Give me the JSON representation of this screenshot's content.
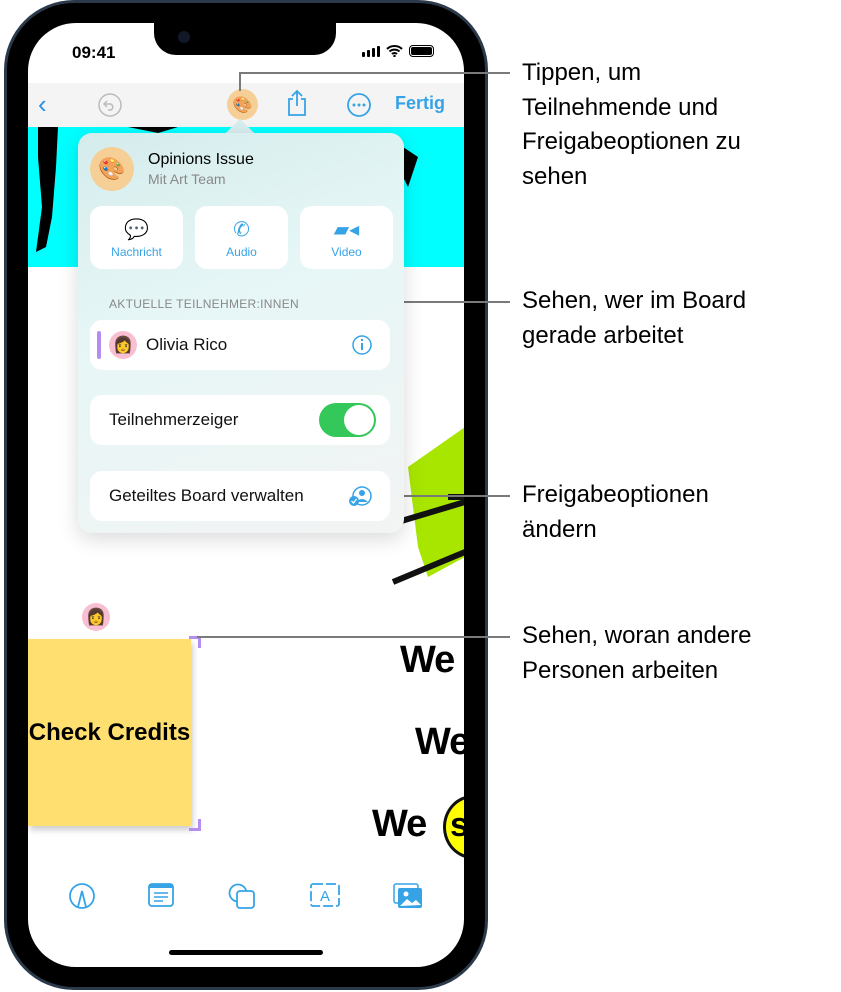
{
  "status_bar": {
    "time": "09:41"
  },
  "nav": {
    "back_icon": "chevron-left-icon",
    "undo_icon": "undo-icon",
    "collab_icon": "palette-icon",
    "share_icon": "share-icon",
    "more_icon": "ellipsis-circle-icon",
    "done_label": "Fertig"
  },
  "popover": {
    "title": "Opinions Issue",
    "subtitle": "Mit Art Team",
    "actions": [
      {
        "label": "Nachricht",
        "icon": "message-icon"
      },
      {
        "label": "Audio",
        "icon": "phone-icon"
      },
      {
        "label": "Video",
        "icon": "video-icon"
      }
    ],
    "section_header": "AKTUELLE TEILNEHMER:INNEN",
    "participant": {
      "name": "Olivia Rico",
      "color": "#b38ef0"
    },
    "pointer_toggle": {
      "label": "Teilnehmerzeiger",
      "on": true
    },
    "manage_label": "Geteiltes Board verwalten"
  },
  "canvas": {
    "sticky_note": "Check Credits",
    "text_fragments": [
      "We",
      "We",
      "We",
      "s"
    ]
  },
  "toolbar": [
    "pen-icon",
    "sticky-note-icon",
    "shapes-icon",
    "text-box-icon",
    "media-icon"
  ],
  "callouts": [
    "Tippen, um Teilnehmende und Freigabeoptionen zu sehen",
    "Sehen, wer im Board gerade arbeitet",
    "Freigabeoptionen ändern",
    "Sehen, woran andere Personen arbeiten"
  ],
  "colors": {
    "accent": "#36a3e6",
    "toggle_on": "#34c759",
    "sticky": "#fedf6f",
    "participant": "#b38ef0"
  }
}
